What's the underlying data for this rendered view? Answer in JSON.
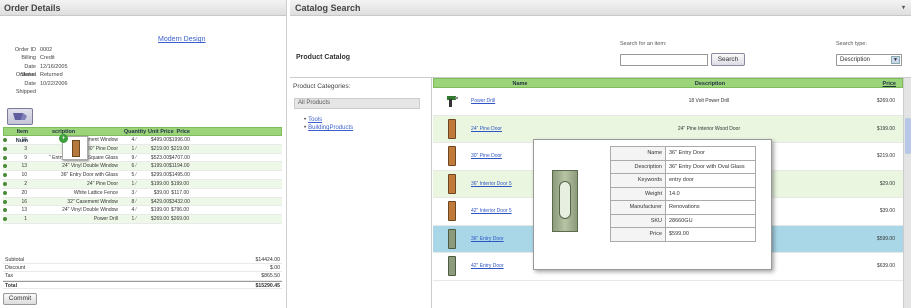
{
  "order": {
    "title": "Order Details",
    "design_link": "Modern Design",
    "fields": [
      {
        "label": "Order ID",
        "value": "0002"
      },
      {
        "label": "Billing",
        "value": "Credit"
      },
      {
        "label": "Date Ordered",
        "value": "12/16/2005"
      },
      {
        "label": "Status",
        "value": "Returned"
      },
      {
        "label": "Date Shipped",
        "value": "10/22/2006"
      }
    ],
    "columns": [
      "Item Num",
      "scription",
      "Quantity",
      "Unit Price",
      "Price"
    ],
    "items": [
      {
        "num": "15",
        "name": "42\" Casement Window",
        "qty": "4",
        "unit": "$499.00",
        "price": "$1996.00"
      },
      {
        "num": "3",
        "name": "30\" Pine Door",
        "qty": "1",
        "unit": "$219.00",
        "price": "$219.00"
      },
      {
        "num": "9",
        "name": "\" Entry Door with Square Glass",
        "qty": "9",
        "unit": "$523.00",
        "price": "$4707.00"
      },
      {
        "num": "13",
        "name": "24\" Vinyl Double Window",
        "qty": "6",
        "unit": "$199.00",
        "price": "$1194.00"
      },
      {
        "num": "10",
        "name": "36\" Entry Door with Glass",
        "qty": "5",
        "unit": "$299.00",
        "price": "$1495.00"
      },
      {
        "num": "2",
        "name": "24\" Pine Door",
        "qty": "1",
        "unit": "$199.00",
        "price": "$199.00"
      },
      {
        "num": "20",
        "name": "White Lattice Fence",
        "qty": "3",
        "unit": "$39.00",
        "price": "$117.00"
      },
      {
        "num": "16",
        "name": "32\" Casement Window",
        "qty": "8",
        "unit": "$429.00",
        "price": "$3432.00"
      },
      {
        "num": "13",
        "name": "24\" Vinyl Double Window",
        "qty": "4",
        "unit": "$199.00",
        "price": "$796.00"
      },
      {
        "num": "1",
        "name": "Power Drill",
        "qty": "1",
        "unit": "$269.00",
        "price": "$269.00"
      }
    ],
    "totals": [
      {
        "label": "Subtotal",
        "value": "$14424.00"
      },
      {
        "label": "Discount",
        "value": "$.00"
      },
      {
        "label": "Tax",
        "value": "$865.50"
      },
      {
        "label": "Total",
        "value": "$15290.45"
      }
    ],
    "commit_label": "Commit"
  },
  "catalog": {
    "title": "Catalog Search",
    "product_catalog": "Product Catalog",
    "search_label": "Search for an item:",
    "search_value": "",
    "search_button": "Search",
    "type_label": "Search type:",
    "type_value": "Description",
    "categories_label": "Product Categories:",
    "all_products": "All Products",
    "categories": [
      "Tools",
      "BuildingProducts"
    ],
    "columns": [
      "Name",
      "Description",
      "Price"
    ],
    "products": [
      {
        "name": "Power Drill",
        "desc": "18 Volt Power Drill",
        "price": "$269.00",
        "img": "drill"
      },
      {
        "name": "24\" Pine Door",
        "desc": "24\" Pine Interior Wood Door",
        "price": "$199.00",
        "img": "door-pine"
      },
      {
        "name": "30\" Pine Door",
        "desc": "",
        "price": "$219.00",
        "img": "door-pine"
      },
      {
        "name": "36\" Interior Door 5",
        "desc": "",
        "price": "$29.00",
        "img": "door-pine"
      },
      {
        "name": "42\" Interior Door 5",
        "desc": "",
        "price": "$39.00",
        "img": "door-pine"
      },
      {
        "name": "36\" Entry Door",
        "desc": "",
        "price": "$599.00",
        "img": "door-entry"
      },
      {
        "name": "42\" Entry Door",
        "desc": "42\" Entry Door with Oval Glass",
        "price": "$639.00",
        "img": "door-entry"
      }
    ],
    "tooltip": [
      {
        "k": "Name",
        "v": "36\" Entry Door"
      },
      {
        "k": "Description",
        "v": "36\" Entry Door with Oval Glass"
      },
      {
        "k": "Keywords",
        "v": "entry door"
      },
      {
        "k": "Weight",
        "v": "14.0"
      },
      {
        "k": "Manufacturer",
        "v": "Renovations"
      },
      {
        "k": "SKU",
        "v": "28660GU"
      },
      {
        "k": "Price",
        "v": "$599.00"
      }
    ]
  },
  "colors": {
    "grid_header": "#9cd47a",
    "row_alt": "#eaf6df",
    "selected_row": "#a9d7e8",
    "link": "#3a5fcd"
  }
}
